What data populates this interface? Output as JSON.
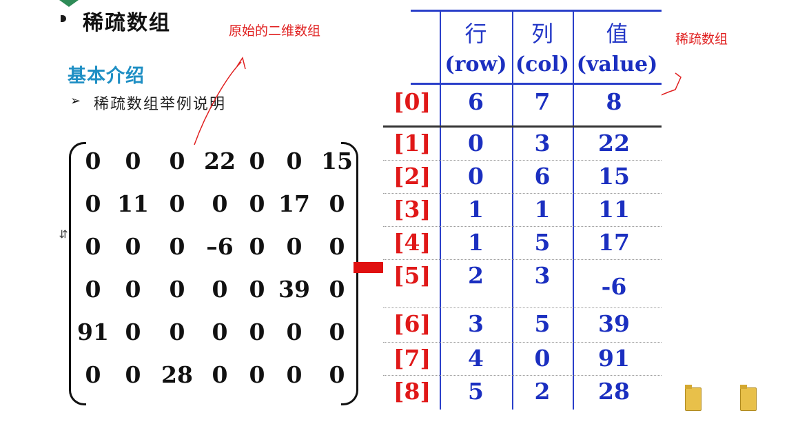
{
  "header": {
    "title": "稀疏数组",
    "original_label": "原始的二维数组",
    "sparse_label": "稀疏数组"
  },
  "intro": {
    "heading": "基本介绍",
    "bullet_arrow": "➢",
    "bullet_text": "稀疏数组举例说明"
  },
  "matrix": {
    "rows": [
      [
        "0",
        "0",
        "0",
        "22",
        "0",
        "0",
        "15"
      ],
      [
        "0",
        "11",
        "0",
        "0",
        "0",
        "17",
        "0"
      ],
      [
        "0",
        "0",
        "0",
        "–6",
        "0",
        "0",
        "0"
      ],
      [
        "0",
        "0",
        "0",
        "0",
        "0",
        "39",
        "0"
      ],
      [
        "91",
        "0",
        "0",
        "0",
        "0",
        "0",
        "0"
      ],
      [
        "0",
        "0",
        "28",
        "0",
        "0",
        "0",
        "0"
      ]
    ]
  },
  "sparse_table": {
    "headers": [
      {
        "cn": "行",
        "en": "(row)"
      },
      {
        "cn": "列",
        "en": "(col)"
      },
      {
        "cn": "值",
        "en": "(value)"
      }
    ],
    "rows": [
      {
        "idx": "[0]",
        "row": "6",
        "col": "7",
        "value": "8"
      },
      {
        "idx": "[1]",
        "row": "0",
        "col": "3",
        "value": "22"
      },
      {
        "idx": "[2]",
        "row": "0",
        "col": "6",
        "value": "15"
      },
      {
        "idx": "[3]",
        "row": "1",
        "col": "1",
        "value": "11"
      },
      {
        "idx": "[4]",
        "row": "1",
        "col": "5",
        "value": "17"
      },
      {
        "idx": "[5]",
        "row": "2",
        "col": "3",
        "value": "-6"
      },
      {
        "idx": "[6]",
        "row": "3",
        "col": "5",
        "value": "39"
      },
      {
        "idx": "[7]",
        "row": "4",
        "col": "0",
        "value": "91"
      },
      {
        "idx": "[8]",
        "row": "5",
        "col": "2",
        "value": "28"
      }
    ]
  },
  "colors": {
    "title_blue": "#1f8fc4",
    "table_blue": "#1b2fc0",
    "index_red": "#e01818",
    "annotation_red": "#e02020"
  },
  "icons": [
    "folder-icon",
    "folder-icon"
  ]
}
